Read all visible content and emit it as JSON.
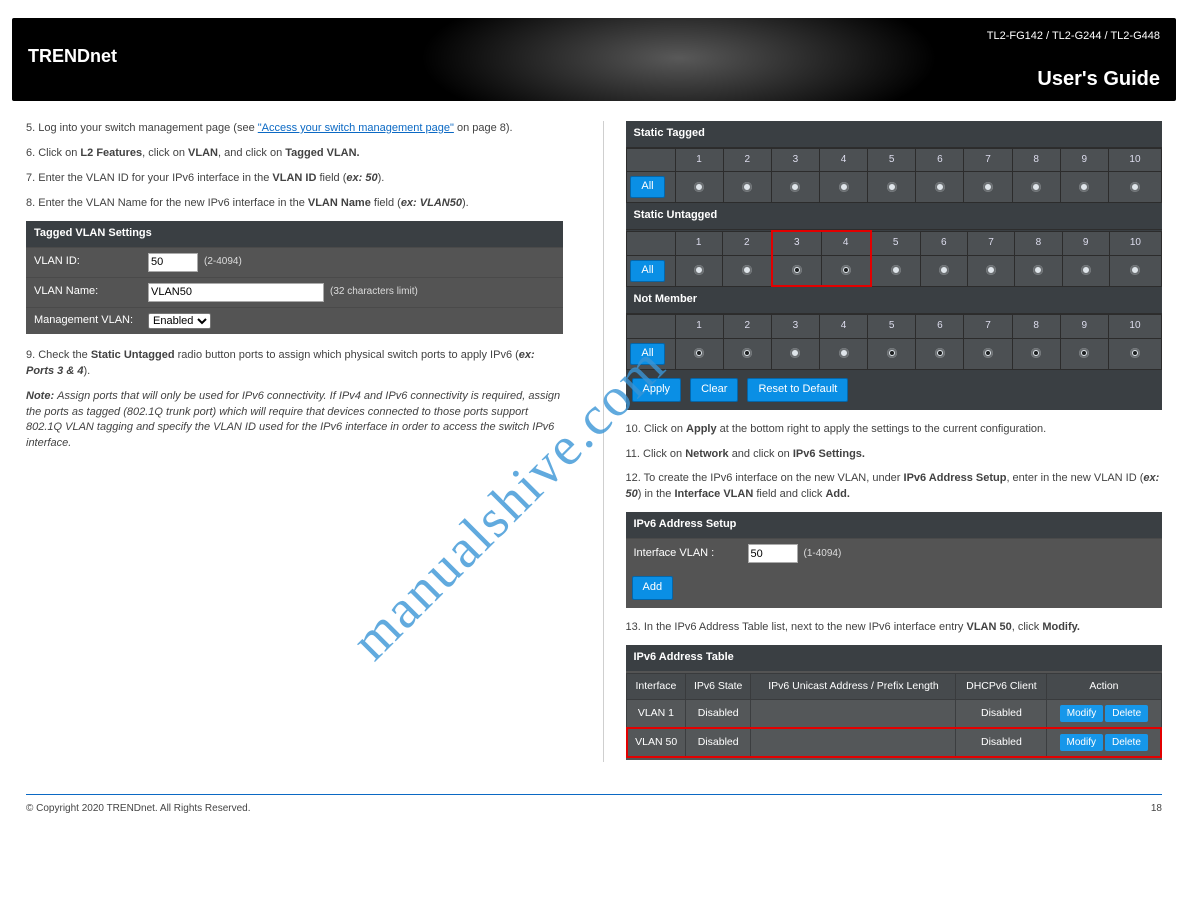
{
  "header": {
    "brand": "TRENDnet",
    "product": "TL2-FG142 / TL2-G244 / TL2-G448",
    "guide": "User's Guide"
  },
  "watermark": "manualshive.com",
  "left": {
    "p1_a": "5. Log into your switch management page (see ",
    "p1_link": "\"Access your switch management page\"",
    "p1_b": " on page 8).",
    "p2_a": "6. Click on ",
    "p2_b": "L2 Features",
    "p2_c": ", click on ",
    "p2_d": "VLAN",
    "p2_e": ", and click on ",
    "p2_f": "Tagged VLAN.",
    "p3_a": "7. Enter the VLAN ID for your IPv6 interface in the ",
    "p3_b": "VLAN ID ",
    "p3_c": "field (",
    "p3_d": "ex: 50",
    "p3_e": ").",
    "p4_a": "8. Enter the VLAN Name for the new IPv6 interface in the ",
    "p4_b": "VLAN Name",
    "p4_c": " field (",
    "p4_d": "ex: VLAN50",
    "p4_e": ").",
    "settings": {
      "title": "Tagged VLAN Settings",
      "vlan_id_label": "VLAN ID:",
      "vlan_id_value": "50",
      "vlan_id_hint": "(2-4094)",
      "vlan_name_label": "VLAN Name:",
      "vlan_name_value": "VLAN50",
      "vlan_name_hint": "(32 characters limit)",
      "mgmt_label": "Management VLAN:",
      "mgmt_value": "Enabled"
    },
    "p5_a": "9. Check the ",
    "p5_b": "Static Untagged ",
    "p5_c": "radio button ports to assign which physical switch ports to apply IPv6 (",
    "p5_d": "ex: Ports 3 & 4",
    "p5_e": ").",
    "note_a": "Note: ",
    "note_b": "Assign ports that will only be used for IPv6 connectivity. If IPv4 and IPv6 connectivity is required, assign the ports as tagged (802.1Q trunk port) which will require that devices connected to those ports support 802.1Q VLAN tagging and specify the VLAN ID used for the IPv6 interface in order to access the switch IPv6 interface."
  },
  "right": {
    "matrix": {
      "tagged_title": "Static Tagged",
      "untagged_title": "Static Untagged",
      "notmember_title": "Not Member",
      "ports": [
        "1",
        "2",
        "3",
        "4",
        "5",
        "6",
        "7",
        "8",
        "9",
        "10"
      ],
      "tagged": [
        false,
        false,
        false,
        false,
        false,
        false,
        false,
        false,
        false,
        false
      ],
      "untagged": [
        false,
        false,
        true,
        true,
        false,
        false,
        false,
        false,
        false,
        false
      ],
      "notmember": [
        true,
        true,
        false,
        false,
        true,
        true,
        true,
        true,
        true,
        true
      ],
      "redbox_ports": [
        3,
        4
      ],
      "all_label": "All",
      "apply": "Apply",
      "clear": "Clear",
      "reset": "Reset to Default"
    },
    "p1_a": "10. Click on ",
    "p1_b": "Apply ",
    "p1_c": "at the bottom right to apply the settings to the current configuration.",
    "p2_a": "11. Click on ",
    "p2_b": "Network ",
    "p2_c": "and click on ",
    "p2_d": "IPv6 Settings.",
    "p3_a": "12. To create the IPv6 interface on the new VLAN, under ",
    "p3_b": "IPv6 Address Setup",
    "p3_c": ", enter in the new VLAN ID (",
    "p3_d": "ex: 50",
    "p3_e": ") in the ",
    "p3_f": "Interface VLAN ",
    "p3_g": "field and click ",
    "p3_h": "Add.",
    "setup": {
      "title": "IPv6 Address Setup",
      "label": "Interface VLAN :",
      "value": "50",
      "hint": "(1-4094)",
      "add": "Add"
    },
    "p4_a": "13. In the IPv6 Address Table list, next to the new IPv6 interface entry ",
    "p4_b": "VLAN 50",
    "p4_c": ", click ",
    "p4_d": "Modify.",
    "table": {
      "title": "IPv6 Address Table",
      "th": [
        "Interface",
        "IPv6 State",
        "IPv6 Unicast Address / Prefix Length",
        "DHCPv6 Client",
        "Action"
      ],
      "rows": [
        {
          "iface": "VLAN 1",
          "state": "Disabled",
          "addr": "",
          "dhcp": "Disabled",
          "highlight": false
        },
        {
          "iface": "VLAN 50",
          "state": "Disabled",
          "addr": "",
          "dhcp": "Disabled",
          "highlight": true
        }
      ],
      "modify": "Modify",
      "delete": "Delete"
    }
  },
  "footer": {
    "copy": "© Copyright 2020 TRENDnet. All Rights Reserved.",
    "page": "18"
  }
}
